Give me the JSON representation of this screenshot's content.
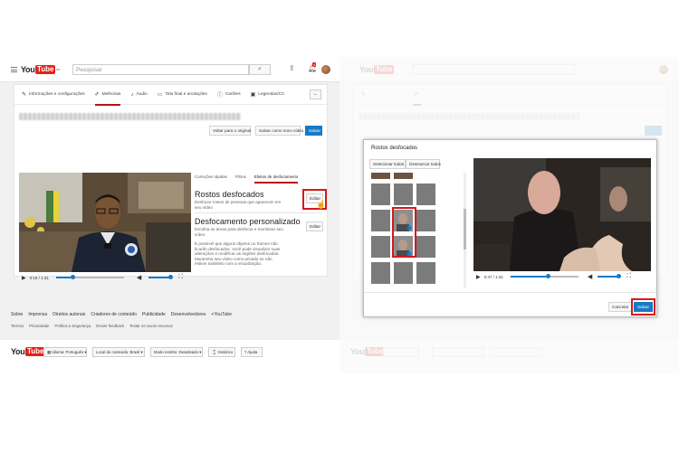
{
  "header": {
    "search_placeholder": "Pesquisar",
    "notification_count": "4"
  },
  "tabs": [
    {
      "label": "Informações e configurações",
      "icon": "info-icon"
    },
    {
      "label": "Melhorias",
      "icon": "wand-icon"
    },
    {
      "label": "Áudio",
      "icon": "music-icon"
    },
    {
      "label": "Tela final e anotações",
      "icon": "film-icon"
    },
    {
      "label": "Cartões",
      "icon": "info-circle-icon"
    },
    {
      "label": "Legendas/CC",
      "icon": "cc-icon"
    }
  ],
  "actions": {
    "revert": "Voltar para o original",
    "save_new": "Salvar como novo vídeo",
    "save": "Salvar"
  },
  "player": {
    "time_left": "0:19 / 1:31",
    "time_right": "0:47 / 1:31"
  },
  "subtabs": [
    "Correções rápidas",
    "Filtros",
    "Efeitos de desfocamento"
  ],
  "faces": {
    "title": "Rostos desfocados",
    "desc": "Desfocar rostos de pessoas que aparecem em seu vídeo",
    "edit": "Editar"
  },
  "custom": {
    "title": "Desfocamento personalizado",
    "desc": "Escolha as áreas para desfocar e monitorar seu vídeo",
    "edit": "Editar"
  },
  "note": "É possível que alguns objetos ou frames não ficarão desfocados. Você pode visualizar suas alterações e modificar as regiões desfocadas. Mantenha seu vídeo como privado se não estiver satisfeito com a visualização.",
  "dialog": {
    "title": "Rostos desfocados",
    "select_all": "Selecionar todos",
    "deselect_all": "Desmarcar todos",
    "cancel": "Cancelar",
    "save": "Salvar"
  },
  "footer": {
    "language": "Idioma: Português",
    "location": "Local do conteúdo: Brasil",
    "restricted": "Modo restrito: Desativado",
    "history": "Histórico",
    "help": "Ajuda",
    "links": [
      "Sobre",
      "Imprensa",
      "Direitos autorais",
      "Criadores de conteúdo",
      "Publicidade",
      "Desenvolvedores",
      "+YouTube"
    ],
    "links2": [
      "Termos",
      "Privacidade",
      "Política e Segurança",
      "Enviar feedback",
      "Testar os novos recursos"
    ]
  },
  "colors": {
    "accent": "#167ac6",
    "brand": "#e62117",
    "highlight": "#d21b1b"
  }
}
